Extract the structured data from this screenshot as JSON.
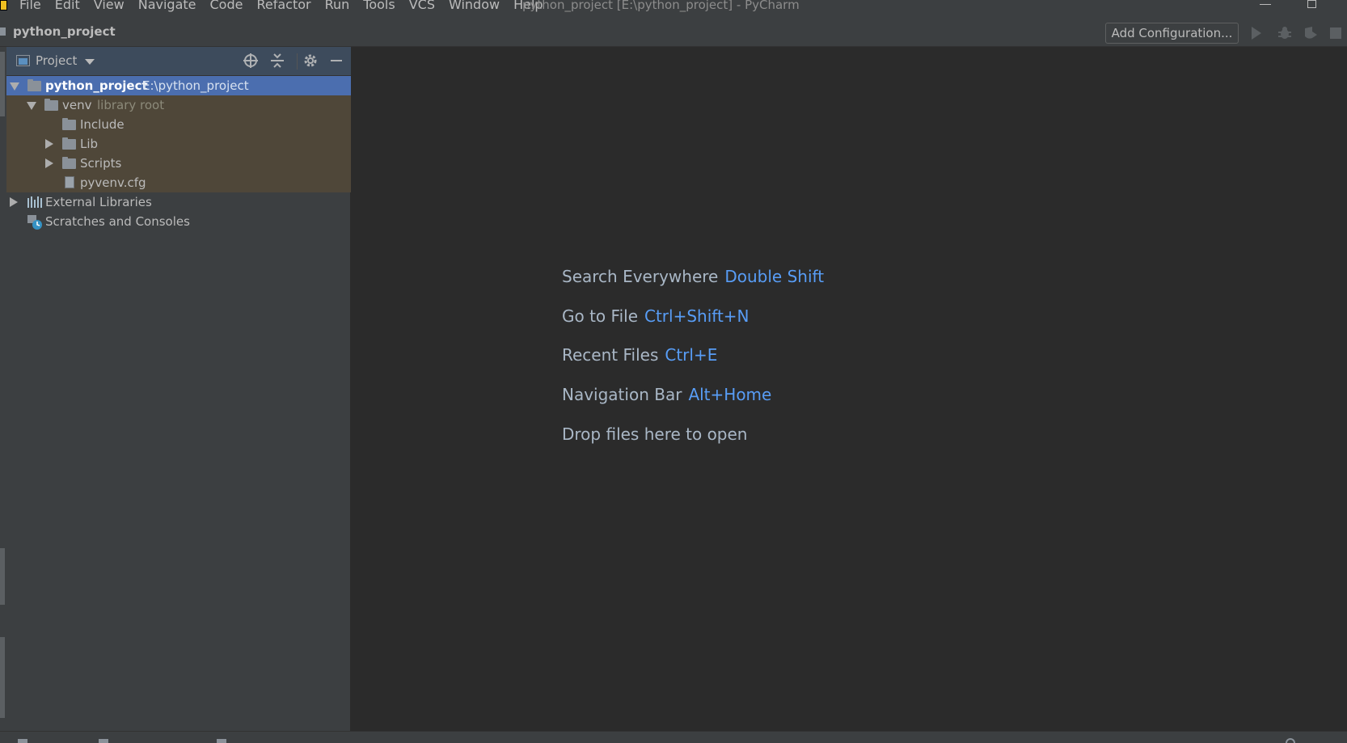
{
  "window": {
    "title": "python_project [E:\\python_project] - PyCharm"
  },
  "menu": [
    "File",
    "Edit",
    "View",
    "Navigate",
    "Code",
    "Refactor",
    "Run",
    "Tools",
    "VCS",
    "Window",
    "Help"
  ],
  "navbar": {
    "breadcrumb": "python_project",
    "add_configuration": "Add Configuration..."
  },
  "project_panel": {
    "title": "Project",
    "tree": [
      {
        "name": "python_project",
        "detail": "E:\\python_project",
        "type": "folder",
        "expanded": true,
        "selected": true
      },
      {
        "name": "venv",
        "detail": "library root",
        "type": "folder",
        "expanded": true
      },
      {
        "name": "Include",
        "type": "folder"
      },
      {
        "name": "Lib",
        "type": "folder",
        "expanded": false
      },
      {
        "name": "Scripts",
        "type": "folder",
        "expanded": false
      },
      {
        "name": "pyvenv.cfg",
        "type": "file"
      },
      {
        "name": "External Libraries",
        "type": "libraries",
        "expanded": false
      },
      {
        "name": "Scratches and Consoles",
        "type": "scratches"
      }
    ]
  },
  "editor_hints": [
    {
      "label": "Search Everywhere",
      "keys": "Double Shift"
    },
    {
      "label": "Go to File",
      "keys": "Ctrl+Shift+N"
    },
    {
      "label": "Recent Files",
      "keys": "Ctrl+E"
    },
    {
      "label": "Navigation Bar",
      "keys": "Alt+Home"
    },
    {
      "label": "Drop files here to open",
      "keys": ""
    }
  ],
  "colors": {
    "accent_link": "#589df6",
    "selection": "#4b6eaf",
    "excluded_bg": "#4f4739",
    "panel_bg": "#3c3f41",
    "editor_bg": "#2b2b2b"
  }
}
